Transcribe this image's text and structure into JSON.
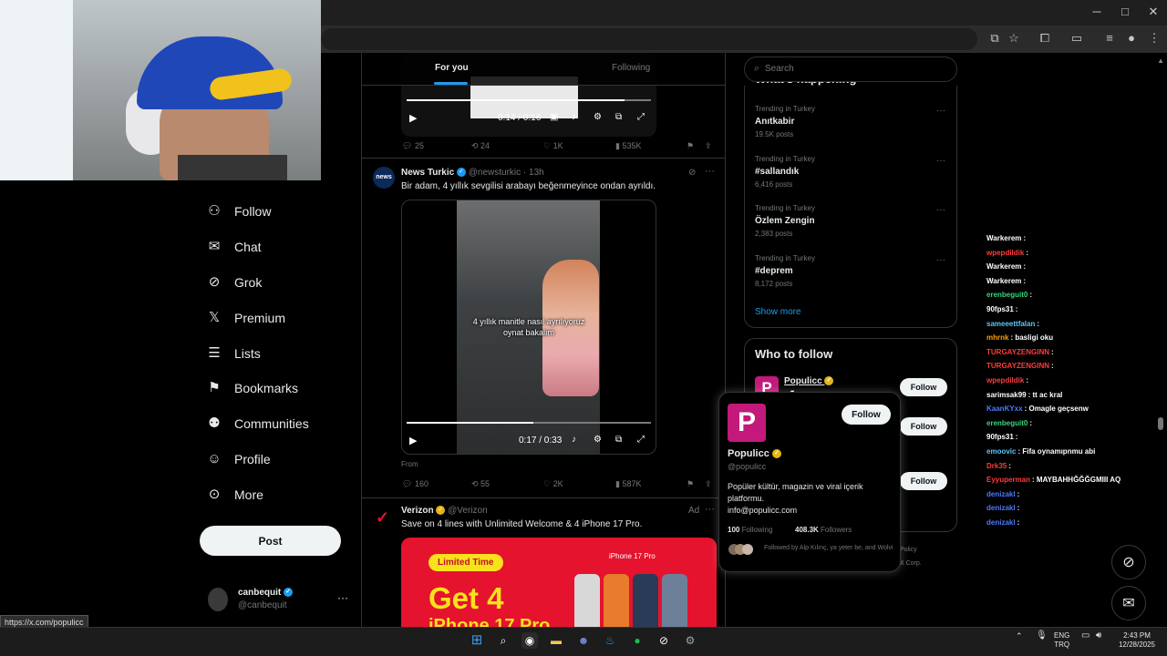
{
  "browser": {
    "status_url": "https://x.com/populicc"
  },
  "colors": {
    "accent": "#1d9bf0",
    "brand_magenta": "#c2197a",
    "verified_gold": "#e5b515"
  },
  "nav": {
    "items": [
      {
        "label": "Follow",
        "icon": "person-plus-icon"
      },
      {
        "label": "Chat",
        "icon": "envelope-icon"
      },
      {
        "label": "Grok",
        "icon": "grok-icon"
      },
      {
        "label": "Premium",
        "icon": "x-logo-icon"
      },
      {
        "label": "Lists",
        "icon": "list-icon"
      },
      {
        "label": "Bookmarks",
        "icon": "bookmark-icon"
      },
      {
        "label": "Communities",
        "icon": "people-icon"
      },
      {
        "label": "Profile",
        "icon": "person-icon"
      },
      {
        "label": "More",
        "icon": "more-circle-icon"
      }
    ],
    "post_label": "Post"
  },
  "account": {
    "name": "canbequit",
    "handle": "@canbequit"
  },
  "tabs": {
    "for_you": "For you",
    "following": "Following"
  },
  "post1": {
    "time": "0:14 / 0:16",
    "progress": 0.89,
    "replies": "25",
    "reposts": "24",
    "likes": "1K",
    "views": "535K"
  },
  "post2": {
    "name": "News Turkic",
    "handle": "@newsturkic",
    "sep": "·",
    "time_ago": "13h",
    "text": "Bir adam, 4 yıllık sevgilisi arabayı beğenmeyince ondan ayrıldı.",
    "caption": "4 yıllık manitle nasıl ayrılıyoruz oynat bakalım",
    "video_time": "0:17 / 0:33",
    "progress": 0.52,
    "from": "From",
    "replies": "160",
    "reposts": "55",
    "likes": "2K",
    "views": "587K"
  },
  "post3": {
    "name": "Verizon",
    "handle": "@Verizon",
    "ad": "Ad",
    "text": "Save on 4 lines with Unlimited Welcome & 4 iPhone 17 Pro.",
    "banner_tag": "Limited Time",
    "banner_big": "Get 4",
    "banner_big2": "iPhone 17 Pro",
    "banner_model": "iPhone 17 Pro"
  },
  "search": {
    "placeholder": "Search"
  },
  "trending": {
    "title": "What's happening",
    "items": [
      {
        "meta": "Trending in Turkey",
        "name": "Anıtkabir",
        "count": "19.5K posts"
      },
      {
        "meta": "Trending in Turkey",
        "name": "#sallandık",
        "count": "6,416 posts"
      },
      {
        "meta": "Trending in Turkey",
        "name": "Özlem Zengin",
        "count": "2,383 posts"
      },
      {
        "meta": "Trending in Turkey",
        "name": "#deprem",
        "count": "8,172 posts"
      }
    ],
    "show_more": "Show more"
  },
  "who_to_follow": {
    "title": "Who to follow",
    "first_name": "Populicc",
    "follow_label": "Follow"
  },
  "hover_card": {
    "name": "Populicc",
    "handle": "@populicc",
    "bio": "Popüler kültür, magazin ve viral içerik platformu.",
    "email": "info@populicc.com",
    "following_count": "100",
    "following_label": "Following",
    "followers_count": "408.3K",
    "followers_label": "Followers",
    "followed_by": "Followed by Alp Kılınç, ya yeter be, and Wolvi",
    "follow_label": "Follow"
  },
  "footer_fragments": {
    "policy": "Policy",
    "corp": "X Corp."
  },
  "chat": [
    {
      "user": "Warkerem",
      "color": "#ffffff",
      "msg": ":"
    },
    {
      "user": "wpepdildik",
      "color": "#ff3b3b",
      "msg": ":"
    },
    {
      "user": "Warkerem",
      "color": "#ffffff",
      "msg": ":"
    },
    {
      "user": "Warkerem",
      "color": "#ffffff",
      "msg": ":"
    },
    {
      "user": "erenbeguit0",
      "color": "#37d67a",
      "msg": ":"
    },
    {
      "user": "90fps31",
      "color": "#ffffff",
      "msg": ":"
    },
    {
      "user": "sameeettfalan",
      "color": "#5ac8fa",
      "msg": ":"
    },
    {
      "user": "mhrnk",
      "color": "#ff9f0a",
      "msg": ": basligi oku"
    },
    {
      "user": "TURGAYZENGINN",
      "color": "#ff3b3b",
      "msg": ":"
    },
    {
      "user": "TURGAYZENGINN",
      "color": "#ff3b3b",
      "msg": ":"
    },
    {
      "user": "wpepdildik",
      "color": "#ff3b3b",
      "msg": ":"
    },
    {
      "user": "sarimsak99",
      "color": "#ffffff",
      "msg": ": tt ac kral"
    },
    {
      "user": "KaanKYxx",
      "color": "#4a7bff",
      "msg": ": Omagle geçsenw"
    },
    {
      "user": "erenbeguit0",
      "color": "#37d67a",
      "msg": ":"
    },
    {
      "user": "90fps31",
      "color": "#ffffff",
      "msg": ":"
    },
    {
      "user": "emoovic",
      "color": "#5ac8fa",
      "msg": ": Fifa oynamıpnmu abi"
    },
    {
      "user": "Drk35",
      "color": "#ff3b3b",
      "msg": ":"
    },
    {
      "user": "Eyyuperman",
      "color": "#ff3b3b",
      "msg": ": MAYBAHHĞĞĞGMIII AQ"
    },
    {
      "user": "denizakl",
      "color": "#4a7bff",
      "msg": ":"
    },
    {
      "user": "denizakl",
      "color": "#4a7bff",
      "msg": ":"
    },
    {
      "user": "denizakl",
      "color": "#4a7bff",
      "msg": ":"
    }
  ],
  "taskbar": {
    "lang": "ENG",
    "layout": "TRQ",
    "time": "2:43 PM",
    "date": "12/28/2025"
  }
}
